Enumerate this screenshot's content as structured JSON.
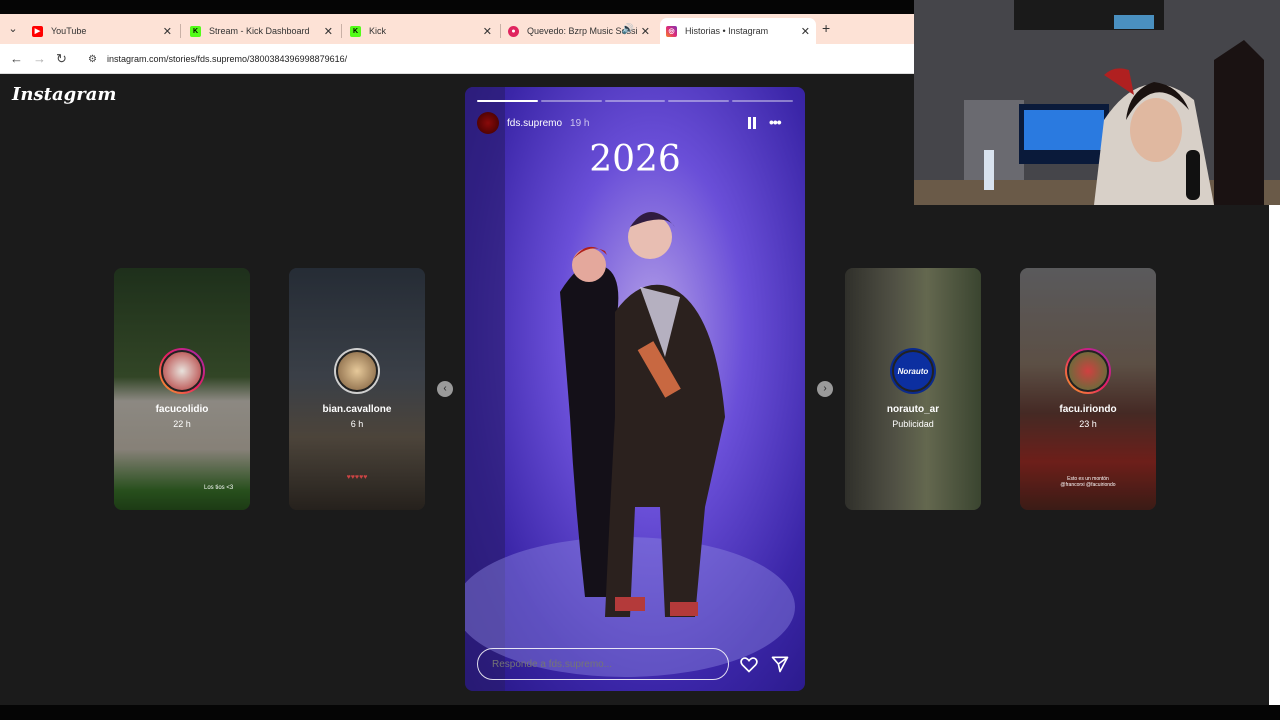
{
  "browser": {
    "tabs": [
      {
        "title": "YouTube",
        "color": "#ff0000"
      },
      {
        "title": "Stream - Kick Dashboard",
        "color": "#53fc18"
      },
      {
        "title": "Kick",
        "color": "#53fc18"
      },
      {
        "title": "Quevedo: Bzrp Music Sessi",
        "color": "#e0245e"
      },
      {
        "title": "Historias • Instagram",
        "color": "#d6249f"
      }
    ],
    "new_tab": "+",
    "url": "instagram.com/stories/fds.supremo/3800384396998879616/"
  },
  "instagram": {
    "logo": "Instagram",
    "story": {
      "username": "fds.supremo",
      "time": "19 h",
      "overlay_text": "2026",
      "reply_placeholder": "Responde a fds.supremo...",
      "progress": [
        1.0,
        0.0,
        0.0,
        0.0,
        0.0
      ]
    },
    "previews": [
      {
        "name": "facucolidio",
        "sub": "22 h",
        "caption": "Los tios <3"
      },
      {
        "name": "bian.cavallone",
        "sub": "6 h",
        "caption": "♥♥♥♥♥"
      },
      {
        "name": "norauto_ar",
        "sub": "Publicidad",
        "badge": "Norauto"
      },
      {
        "name": "facu.iriondo",
        "sub": "23 h",
        "caption": "Esto es un montón\n@francorxi @facuiriondo"
      }
    ]
  }
}
